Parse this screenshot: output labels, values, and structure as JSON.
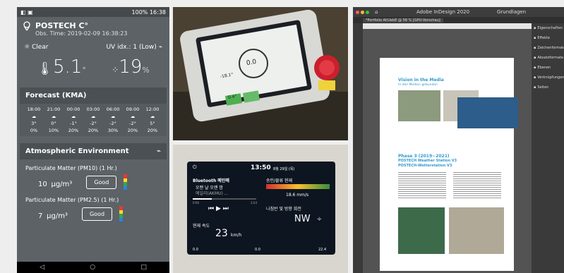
{
  "phone": {
    "status_left": "◧ ▣",
    "status_right": "100% 16:38",
    "station_title": "POSTECH C°",
    "obs_time": "Obs. Time: 2019-02-09 16:38:23",
    "condition": "Clear",
    "uv": "UV idx.: 1 (Low)",
    "temp_value": "5.1",
    "temp_unit": "°",
    "humidity_value": "19",
    "humidity_unit": "%",
    "forecast_title": "Forecast (KMA)",
    "forecast_times": [
      "18:00",
      "21:00",
      "00:00",
      "03:00",
      "06:00",
      "09:00",
      "12:00"
    ],
    "forecast_temps": [
      "3°",
      "0°",
      "-1°",
      "-2°",
      "-2°",
      "-2°",
      "5°"
    ],
    "forecast_precip": [
      "0%",
      "10%",
      "20%",
      "20%",
      "30%",
      "20%",
      "20%"
    ],
    "atmos_title": "Atmospheric Environment",
    "pm10_label": "Particulate Matter (PM10) (1 Hr.)",
    "pm10_value": "10",
    "pm10_unit": "μg/m³",
    "pm10_status": "Good",
    "pm25_label": "Particulate Matter (PM2.5) (1 Hr.)",
    "pm25_value": "7",
    "pm25_unit": "μg/m³",
    "pm25_status": "Good",
    "nav": [
      "◁",
      "○",
      "□"
    ]
  },
  "device": {
    "value1": "-18.1°",
    "value2": "0.0",
    "value3": "0.4°"
  },
  "dash": {
    "time": "13:50",
    "date": "8월 29일 (목)",
    "bt_label": "Bluetooth 메인메",
    "song1": "오랜 날 오랜 밤",
    "song2": "에일리(AKMU) ...",
    "time_start": "0:00",
    "time_end": "3:24",
    "cat_label": "승인/물류 현재",
    "speed_label": "현재 속도",
    "speed_value": "23",
    "speed_unit": "km/h",
    "dist_value": "18.6",
    "dist_unit": "mm/s",
    "dir_label": "나침반 및 방향 회전",
    "dir_value": "NW",
    "bottom_left": "0.0",
    "bottom_mid": "0.0",
    "bottom_right": "22.4"
  },
  "indesign": {
    "app_title": "Adobe InDesign 2020",
    "workspace": "Grundlagen",
    "tab": "*Portfolio AtiUebE @ 58 % [GPU-Vorschau]",
    "side": [
      "Eigenschaften",
      "Effekte",
      "Zeichenformate",
      "Absatzformate",
      "Ebenen",
      "Verknüpfungen",
      "Seiten"
    ],
    "doc_heading1": "Vision in the Media",
    "doc_sub1": "In den Medien gebunden",
    "doc_heading2": "Phase 3 (2019~2021)",
    "doc_sub2": "POSTECH Weather Station V3",
    "doc_sub3": "POSTECH-Wetterstation V3"
  }
}
